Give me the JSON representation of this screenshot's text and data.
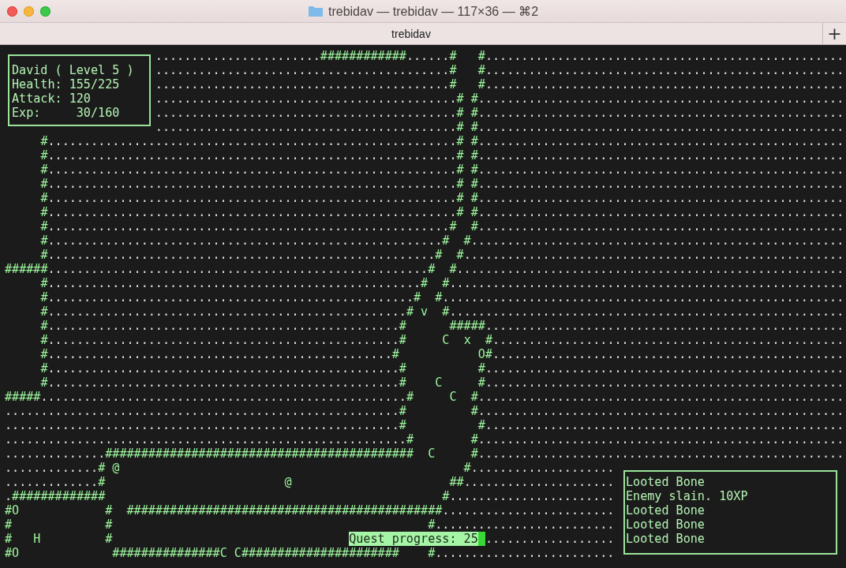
{
  "window": {
    "title": "trebidav — trebidav — 117×36 — ⌘2"
  },
  "tabs": [
    {
      "label": "trebidav",
      "selected": true
    }
  ],
  "new_tab_button": "+",
  "map_rows": [
    [
      "                     .......................############......#",
      "   #.................................................."
    ],
    [
      "                     .........................................#",
      "   #.................................................."
    ],
    [
      "                     .........................................#",
      "   #.................................................."
    ],
    [
      "                     ..........................................# #..................................................."
    ],
    [
      "                     ..........................................# #..................................................."
    ],
    [
      "                     ..........................................# #..................................................."
    ],
    [
      "     #.........................................................# #..................................................."
    ],
    [
      "     #.........................................................# #..................................................."
    ],
    [
      "     #.........................................................# #..................................................."
    ],
    [
      "     #.........................................................# #..................................................."
    ],
    [
      "     #.........................................................# #..................................................."
    ],
    [
      "     #.........................................................# #..................................................."
    ],
    [
      "     #........................................................#",
      "  #..................................................."
    ],
    [
      "     #.......................................................#",
      "  #...................................................."
    ],
    [
      "     #......................................................#",
      "  #....................................................."
    ],
    [
      "######.....................................................#",
      "  #......................................................"
    ],
    [
      "     #....................................................#",
      "  #......................................................."
    ],
    [
      "     #...................................................#",
      "  #........................................................"
    ],
    [
      "     #..................................................# v",
      "  #......................................................."
    ],
    [
      "     #.................................................#",
      "      #####.................................................."
    ],
    [
      "     #.................................................#",
      "     C",
      "  x",
      "  #................................................."
    ],
    [
      "     #................................................#",
      "           O#................................................."
    ],
    [
      "     #.................................................#",
      "          #.................................................."
    ],
    [
      "     #.................................................#",
      "    C",
      "     #.................................................."
    ],
    [
      "#####...................................................#",
      "     C",
      "  #..................................................."
    ],
    [
      ".......................................................#",
      "         #..................................................."
    ],
    [
      ".......................................................#",
      "          #.................................................."
    ],
    [
      "........................................................#",
      "        #..................................................."
    ],
    [
      "..............###########################################",
      "  C",
      "     #..................................................."
    ],
    [
      ".............# @",
      "                                                #...................."
    ],
    [
      ".............#",
      "                         @",
      "                      ##....................."
    ],
    [
      ".#############",
      "                                               #......................."
    ],
    [
      "#O",
      "            #",
      "  ############################################........................"
    ],
    [
      "#",
      "             #",
      "                                            #........................."
    ],
    [
      "#   H",
      "         #",
      "                                                    .................."
    ],
    [
      "#O",
      "             ###############C C######################",
      "    #........................."
    ]
  ],
  "stats_panel": [
    "David ( Level 5 )",
    "Health: 155/225",
    "Attack: 120",
    "Exp:     30/160"
  ],
  "quest_progress": "Quest progress: 25",
  "message_log": [
    "Looted Bone",
    "Enemy slain. 10XP",
    "Looted Bone",
    "Looted Bone",
    "Looted Bone"
  ]
}
